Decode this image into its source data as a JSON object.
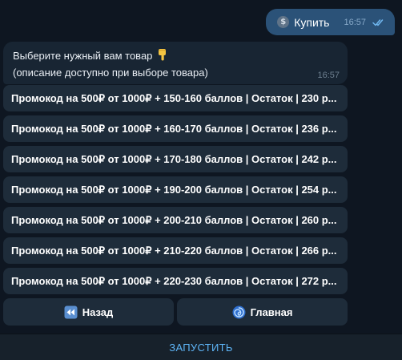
{
  "outgoing": {
    "icon": "dollar-coin-icon",
    "text": "Купить",
    "time": "16:57",
    "status_icon": "double-check-icon"
  },
  "incoming": {
    "line1": "Выберите нужный вам товар",
    "line1_icon": "pointing-down-hand-icon",
    "line2": "(описание доступно при выборе товара)",
    "time": "16:57"
  },
  "keyboard": {
    "items": [
      {
        "label": "Промокод на 500₽ от 1000₽ + 150-160 баллов | Остаток | 230 р..."
      },
      {
        "label": "Промокод на 500₽ от 1000₽ + 160-170 баллов | Остаток | 236 р..."
      },
      {
        "label": "Промокод на 500₽ от 1000₽ + 170-180 баллов | Остаток | 242 р..."
      },
      {
        "label": "Промокод на 500₽ от 1000₽ + 190-200 баллов | Остаток | 254 р..."
      },
      {
        "label": "Промокод на 500₽ от 1000₽ + 200-210 баллов | Остаток | 260 р..."
      },
      {
        "label": "Промокод на 500₽ от 1000₽ + 210-220 баллов | Остаток | 266 р..."
      },
      {
        "label": "Промокод на 500₽ от 1000₽ + 220-230 баллов | Остаток | 272 р..."
      }
    ],
    "back": {
      "label": "Назад",
      "icon": "rewind-icon"
    },
    "home": {
      "label": "Главная",
      "icon": "cyclone-icon"
    }
  },
  "bottom_bar": {
    "label": "ЗАПУСТИТЬ"
  },
  "colors": {
    "background": "#0e1621",
    "outgoing_bubble": "#2b5278",
    "incoming_bubble": "#182533",
    "keyboard_button": "#1e2c3a",
    "accent": "#5eb5f7"
  }
}
